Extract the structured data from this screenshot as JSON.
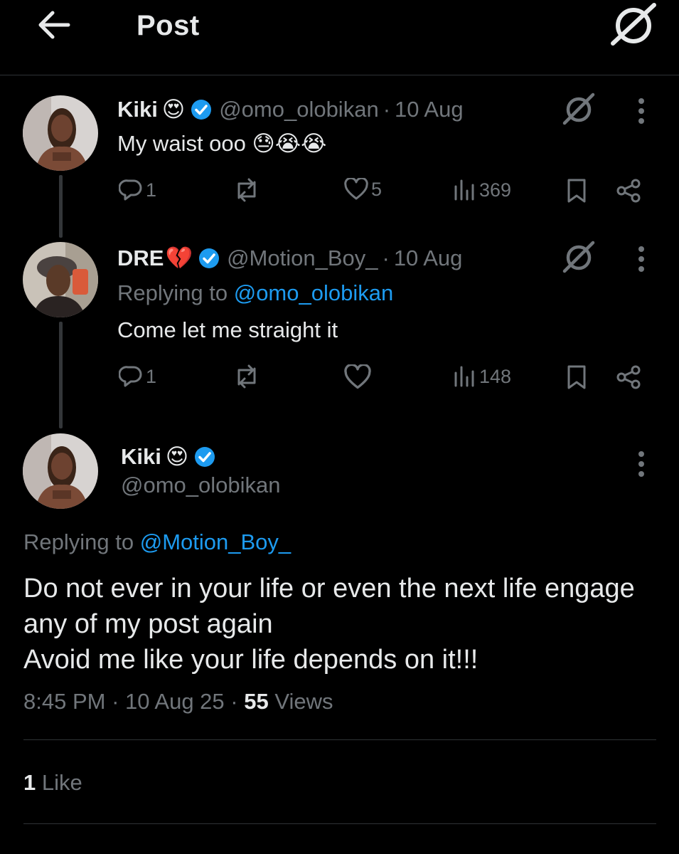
{
  "header": {
    "title": "Post",
    "back_icon": "arrow-left-icon",
    "grok_icon": "grok-icon"
  },
  "tweets": [
    {
      "name": "Kiki",
      "name_emoji": "😍",
      "handle": "@omo_olobikan",
      "date": "10 Aug",
      "text": "My waist ooo",
      "text_emoji": "😓😭😭",
      "stats": {
        "replies": "1",
        "reposts": "",
        "likes": "5",
        "views": "369"
      }
    },
    {
      "name": "DRE",
      "name_emoji": "💔",
      "handle": "@Motion_Boy_",
      "date": "10 Aug",
      "replying_label": "Replying to",
      "replying_to": "@omo_olobikan",
      "text": "Come let me straight it",
      "stats": {
        "replies": "1",
        "reposts": "",
        "likes": "",
        "views": "148"
      }
    }
  ],
  "main": {
    "name": "Kiki",
    "name_emoji": "😍",
    "handle": "@omo_olobikan",
    "replying_label": "Replying to",
    "replying_to": "@Motion_Boy_",
    "body_lines": [
      "Do not ever in your life or even the next life engage",
      "any of my post again",
      "Avoid me like your life depends on it!!!"
    ],
    "time": "8:45 PM",
    "date": "10 Aug 25",
    "views_count": "55",
    "views_label": "Views",
    "likes_count": "1",
    "likes_label": "Like"
  },
  "colors": {
    "background": "#000000",
    "text": "#e7e9ea",
    "muted": "#71767b",
    "accent": "#1d9bf0",
    "divider": "#2f3336"
  }
}
